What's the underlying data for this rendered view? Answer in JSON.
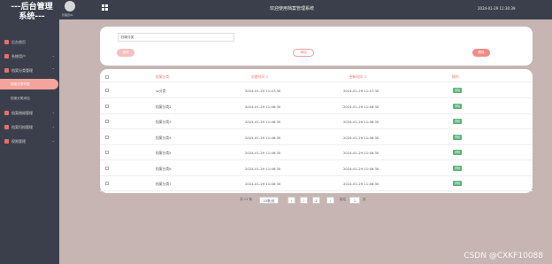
{
  "header": {
    "brand_line1": "---后台管理",
    "brand_line2": "系统---",
    "avatar_label": "管理员91",
    "system_title": "欢迎使用档案管理系统",
    "datetime": "2024-01-29 11:30:39"
  },
  "sidebar": {
    "items": [
      {
        "label": "后台首页",
        "chev": ""
      },
      {
        "label": "系统用户",
        "chev": "⌄"
      },
      {
        "label": "档案分类管理",
        "chev": "⌃"
      },
      {
        "label": "档案借阅管理",
        "chev": "⌄"
      },
      {
        "label": "档案归档管理",
        "chev": "⌄"
      },
      {
        "label": "权限管理",
        "chev": "⌄"
      }
    ],
    "subitems": [
      {
        "label": "档案分类列表"
      },
      {
        "label": "档案分类添加"
      }
    ]
  },
  "search": {
    "value": "档案分类",
    "search_btn": "查询",
    "add_btn": "添加",
    "delete_btn": "删除"
  },
  "table": {
    "headers": [
      "档案分类",
      "创建时间 ↕",
      "更新时间 ↕",
      "操作"
    ],
    "rows": [
      {
        "name": "ss分类",
        "created": "2024-01-29 11:47:30",
        "updated": "2024-01-29 11:47:30",
        "action": "详情"
      },
      {
        "name": "档案分类2",
        "created": "2024-01-29 11:46:30",
        "updated": "2024-01-29 11:46:30",
        "action": "详情"
      },
      {
        "name": "档案分类3",
        "created": "2024-01-29 11:46:30",
        "updated": "2024-01-29 11:46:30",
        "action": "详情"
      },
      {
        "name": "档案分类4",
        "created": "2024-01-29 11:46:30",
        "updated": "2024-01-29 11:46:30",
        "action": "详情"
      },
      {
        "name": "档案分类5",
        "created": "2024-01-29 11:46:30",
        "updated": "2024-01-29 11:46:30",
        "action": "详情"
      },
      {
        "name": "档案分类6",
        "created": "2024-01-29 11:46:30",
        "updated": "2024-01-29 11:46:30",
        "action": "详情"
      },
      {
        "name": "档案分类7",
        "created": "2024-01-29 11:46:30",
        "updated": "2024-01-29 11:46:30",
        "action": "详情"
      }
    ]
  },
  "pagination": {
    "total": "共 11 条",
    "page_size": "10条/页",
    "prev": "‹",
    "pages": [
      "1",
      "2"
    ],
    "next": "›",
    "goto_label": "前往",
    "goto_value": "1",
    "goto_suffix": "页"
  },
  "watermark": "CSDN @CXKF10088",
  "colors": {
    "accent": "#e87a74",
    "sidebar_bg": "#3a3f4b",
    "page_bg": "#c6b5b3",
    "badge": "#5bb27a"
  }
}
